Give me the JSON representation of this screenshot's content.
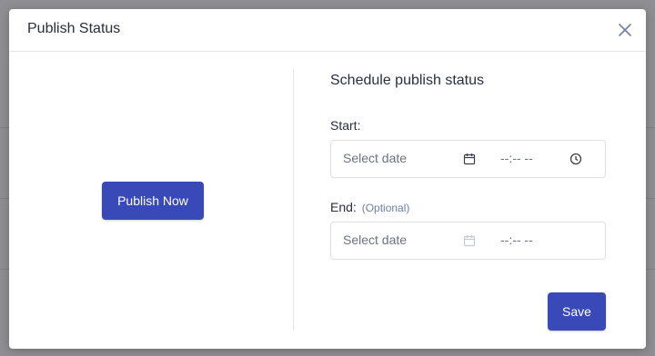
{
  "modal": {
    "title": "Publish Status",
    "close_icon": "close-icon"
  },
  "left": {
    "publish_now_label": "Publish Now"
  },
  "schedule": {
    "title": "Schedule publish status",
    "start": {
      "label": "Start:",
      "date_placeholder": "Select date",
      "time_value": "--:-- --",
      "date_icon": "calendar-icon",
      "time_icon": "clock-icon"
    },
    "end": {
      "label": "End:",
      "optional_label": "(Optional)",
      "date_placeholder": "Select date",
      "time_value": "--:-- --",
      "date_icon": "calendar-icon"
    },
    "save_label": "Save"
  },
  "colors": {
    "primary": "#3a49b8",
    "overlay": "#8f8f93",
    "text": "#27303f",
    "optional": "#6e7fa8",
    "border": "#dcdfe4"
  }
}
